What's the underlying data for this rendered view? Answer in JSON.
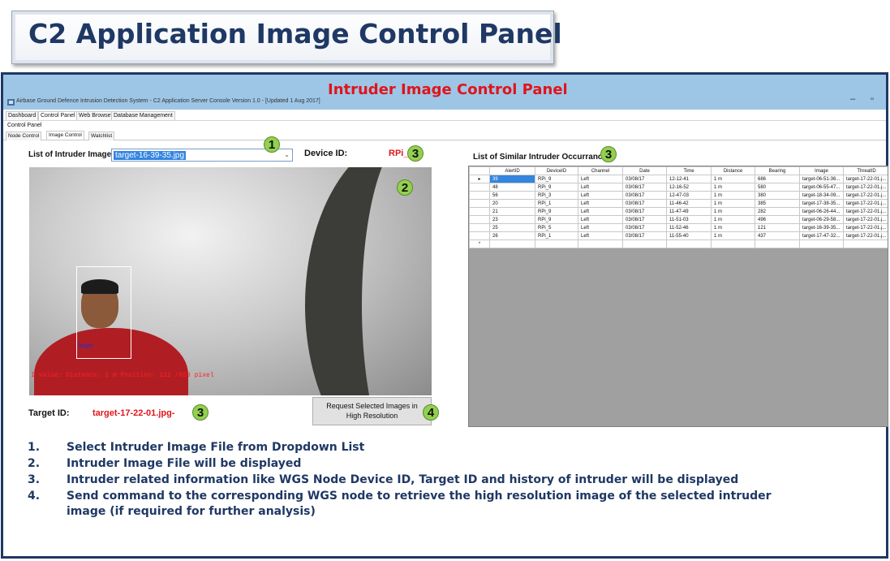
{
  "slide_title": "C2 Application Image Control Panel",
  "window": {
    "panel_heading": "Intruder Image Control Panel",
    "title": "Airbase Ground Defence Intrusion Detection System - C2 Application Server Console Version 1.0 - [Updated 1 Aug 2017]",
    "minimize": "–",
    "restore": "▫"
  },
  "menu_tabs": [
    "Dashboard",
    "Control Panel",
    "Web Browser",
    "Database Management"
  ],
  "control_panel_label": "Control Panel",
  "sub_tabs": [
    "Node Control",
    "Image Control",
    "Watchlist"
  ],
  "image_list": {
    "label": "List of Intruder Images",
    "selected": "target-16-39-35.jpg",
    "chevron": "⌄"
  },
  "device": {
    "label": "Device ID:",
    "value": "RPi_5"
  },
  "image_view": {
    "detection_label": "Target",
    "overlay_text": "I value: Distance: 1 m Position: 121 /853 pixel"
  },
  "target": {
    "label": "Target ID:",
    "value": "target-17-22-01.jpg-"
  },
  "request_button": {
    "line1": "Request Selected Images in",
    "line2": "High Resolution"
  },
  "similar": {
    "label": "List of Similar Intruder Occurrance",
    "columns": [
      "AlertID",
      "DeviceID",
      "Channel",
      "Date",
      "Time",
      "Distance",
      "Bearing",
      "Image",
      "ThreatID"
    ],
    "rows": [
      [
        "39",
        "RPi_9",
        "Left",
        "03/08/17",
        "12-12-41",
        "1 m",
        "686",
        "target-06-51-36...",
        "target-17-22-01.j..."
      ],
      [
        "48",
        "RPi_9",
        "Left",
        "03/08/17",
        "12-16-52",
        "1 m",
        "580",
        "target-06-55-47...",
        "target-17-22-01.j..."
      ],
      [
        "56",
        "RPi_3",
        "Left",
        "03/08/17",
        "12-47-03",
        "1 m",
        "380",
        "target-18-34-09...",
        "target-17-22-01.j..."
      ],
      [
        "20",
        "RPi_1",
        "Left",
        "03/08/17",
        "11-46-42",
        "1 m",
        "385",
        "target-17-38-35...",
        "target-17-22-01.j..."
      ],
      [
        "21",
        "RPi_9",
        "Left",
        "03/08/17",
        "11-47-49",
        "1 m",
        "282",
        "target-06-26-44...",
        "target-17-22-01.j..."
      ],
      [
        "23",
        "RPi_9",
        "Left",
        "03/08/17",
        "11-51-03",
        "1 m",
        "496",
        "target-06-29-58...",
        "target-17-22-01.j..."
      ],
      [
        "25",
        "RPi_5",
        "Left",
        "03/08/17",
        "11-52-46",
        "1 m",
        "121",
        "target-16-39-35...",
        "target-17-22-01.j..."
      ],
      [
        "26",
        "RPi_1",
        "Left",
        "03/08/17",
        "11-55-40",
        "1 m",
        "437",
        "target-17-47-32...",
        "target-17-22-01.j..."
      ]
    ],
    "current_row_marker": "▸",
    "new_row_marker": "*"
  },
  "callouts": {
    "c1": "1",
    "c2": "2",
    "c3": "3",
    "c4": "4"
  },
  "instructions": [
    {
      "num": "1.",
      "text": "Select Intruder Image File from Dropdown List"
    },
    {
      "num": "2.",
      "text": "Intruder Image File will be displayed"
    },
    {
      "num": "3.",
      "text": "Intruder related information like WGS Node Device ID, Target ID and history of intruder will be displayed"
    },
    {
      "num": "4.",
      "text": "Send command to the corresponding WGS node to retrieve the high resolution image of the selected intruder image (if required for further analysis)"
    }
  ],
  "colors": {
    "title_navy": "#1f3864",
    "accent_red": "#e0141b",
    "callout_green": "#92d050",
    "titlebar_blue": "#9dc6e6",
    "selection_blue": "#3385e0"
  }
}
